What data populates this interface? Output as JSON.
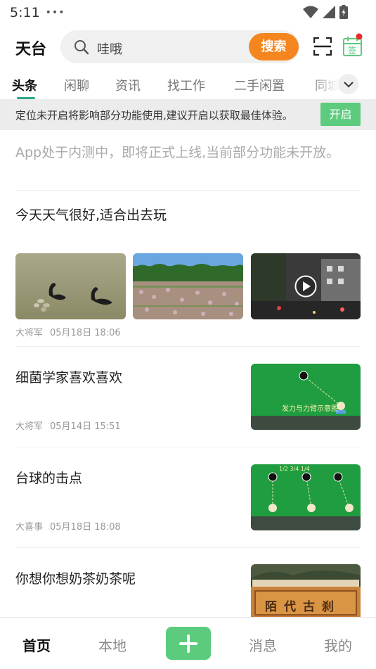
{
  "status_bar": {
    "time": "5:11",
    "dots": "•••"
  },
  "header": {
    "title": "天台",
    "search": {
      "value": "哇哦",
      "button_label": "搜索"
    },
    "checkin_label": "签"
  },
  "tabs": [
    "头条",
    "闲聊",
    "资讯",
    "找工作",
    "二手闲置",
    "同城"
  ],
  "banner": {
    "text": "定位未开启将影响部分功能使用,建议开启以获取最佳体验。",
    "button_label": "开启"
  },
  "notice": "App处于内测中，即将正式上线,当前部分功能未开放。",
  "posts": [
    {
      "title": "今天天气很好,适合出去玩",
      "author": "大将军",
      "date": "05月18日 18:06"
    },
    {
      "title": "细菌学家喜欢喜欢",
      "author": "大将军",
      "date": "05月14日 15:51",
      "thumb_caption": "发力与力臂示意图"
    },
    {
      "title": "台球的击点",
      "author": "大喜事",
      "date": "05月18日 18:08",
      "thumb_caption": "1/2 3/4 1/4"
    },
    {
      "title": "你想你想奶茶奶茶呢",
      "thumb_caption": "陌代古刹"
    }
  ],
  "bottom_nav": [
    "首页",
    "本地",
    "消息",
    "我的"
  ],
  "colors": {
    "accent": "#2aa88a",
    "orange": "#f5861f",
    "green": "#5ccb7d"
  }
}
